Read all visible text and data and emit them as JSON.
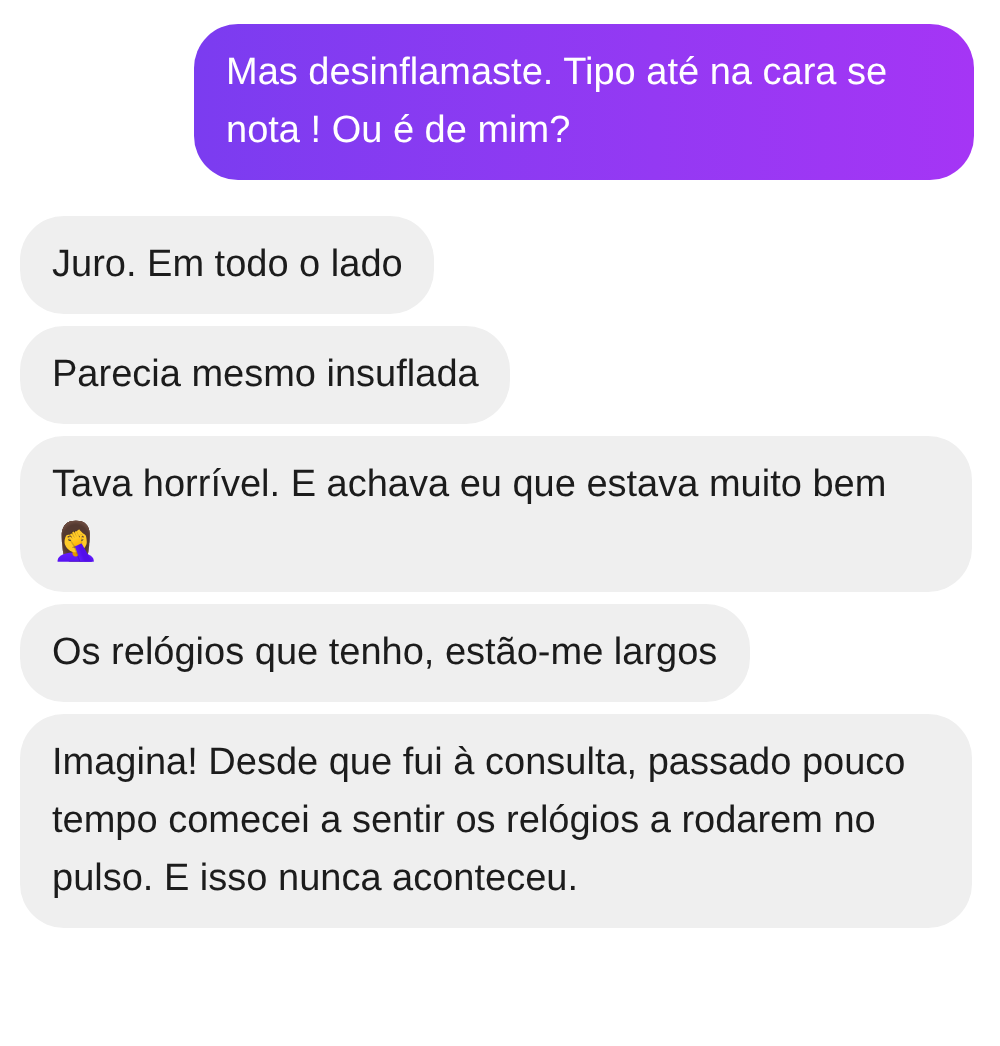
{
  "messages": [
    {
      "kind": "sent",
      "text": "Mas desinflamaste. Tipo até na cara se nota ! Ou é de mim?"
    },
    {
      "kind": "received",
      "text": "Juro. Em todo o lado"
    },
    {
      "kind": "received",
      "text": "Parecia mesmo insuflada"
    },
    {
      "kind": "received",
      "text": "Tava horrível. E achava eu que estava muito bem 🤦‍♀️"
    },
    {
      "kind": "received",
      "text": "Os relógios que tenho, estão-me largos"
    },
    {
      "kind": "received",
      "text": "Imagina! Desde que fui à consulta, passado pouco tempo comecei a sentir os relógios a rodarem no pulso. E isso nunca aconteceu."
    }
  ]
}
